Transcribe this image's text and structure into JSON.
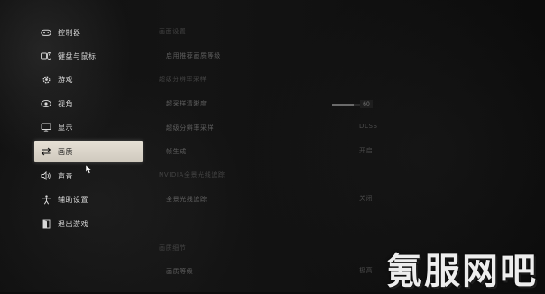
{
  "sidebar": {
    "items": [
      {
        "label": "控制器",
        "icon": "gamepad-icon"
      },
      {
        "label": "键盘与鼠标",
        "icon": "keyboard-mouse-icon"
      },
      {
        "label": "游戏",
        "icon": "gear-icon"
      },
      {
        "label": "视角",
        "icon": "eye-icon"
      },
      {
        "label": "显示",
        "icon": "monitor-icon"
      },
      {
        "label": "画质",
        "icon": "swap-arrows-icon"
      },
      {
        "label": "声音",
        "icon": "speaker-icon"
      },
      {
        "label": "辅助设置",
        "icon": "accessibility-icon"
      },
      {
        "label": "退出游戏",
        "icon": "exit-door-icon"
      }
    ],
    "active_index": 5
  },
  "content": {
    "section1": "画面设置",
    "row1_label": "启用推荐画质等级",
    "section2": "超级分辨率采样",
    "row2_label": "超采样清晰度",
    "row2_value": "60",
    "row2_fraction": 0.6,
    "row3_label": "超级分辨率采样",
    "row3_value": "DLSS",
    "row4_label": "帧生成",
    "row4_value": "开启",
    "section3": "NVIDIA全景光线追踪",
    "row5_label": "全景光线追踪",
    "row5_value": "关闭",
    "section4": "画质细节",
    "row6_label": "画质等级",
    "row6_value": "极高"
  },
  "watermark": "氪服网吧",
  "colors": {
    "active_bg": "#e6e1d6",
    "text": "#d8d8d8",
    "background": "#0d0d0d"
  }
}
